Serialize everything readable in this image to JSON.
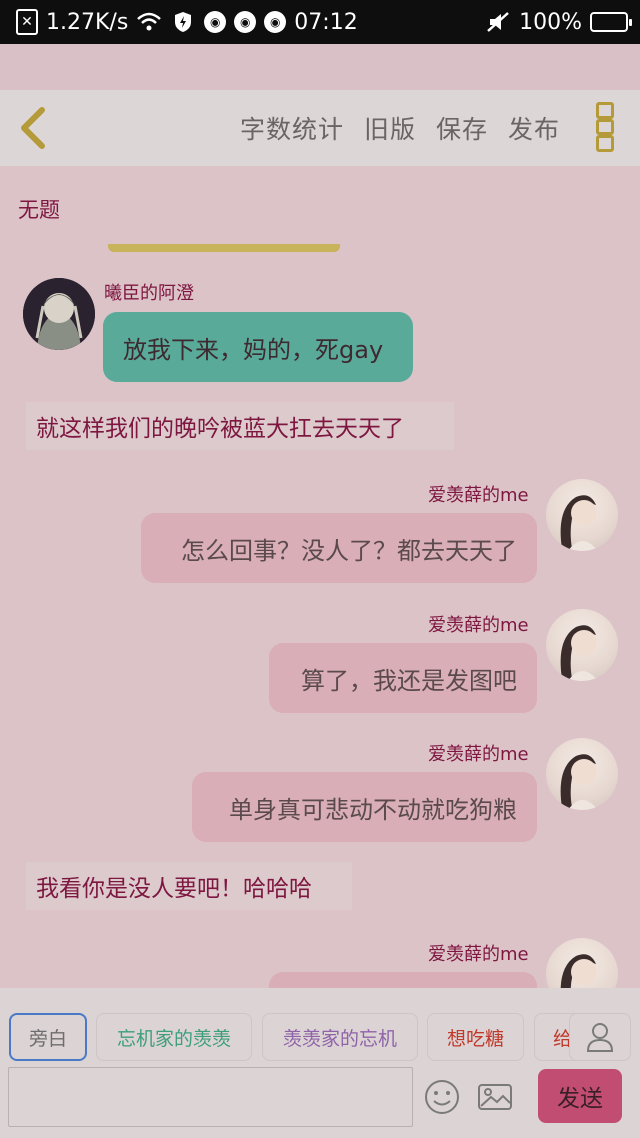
{
  "status_bar": {
    "net_speed": "1.27K/s",
    "time": "07:12",
    "battery": "100%"
  },
  "toolbar": {
    "actions": [
      "字数统计",
      "旧版",
      "保存",
      "发布"
    ]
  },
  "document": {
    "title": "无题"
  },
  "messages": [
    {
      "kind": "left",
      "name": "曦臣的阿澄",
      "text": "放我下来，妈的，死gay"
    },
    {
      "kind": "narration",
      "text": "就这样我们的晚吟被蓝大扛去天天了"
    },
    {
      "kind": "right",
      "name": "爱羡薛的me",
      "text": "怎么回事？没人了？都去天天了"
    },
    {
      "kind": "right",
      "name": "爱羡薛的me",
      "text": "算了，我还是发图吧"
    },
    {
      "kind": "right",
      "name": "爱羡薛的me",
      "text": "单身真可悲动不动就吃狗粮"
    },
    {
      "kind": "narration",
      "text": "我看你是没人要吧！哈哈哈"
    },
    {
      "kind": "right",
      "name": "爱羡薛的me",
      "text": ""
    }
  ],
  "role_chips": [
    {
      "label": "旁白",
      "color": "#6d6d6d"
    },
    {
      "label": "忘机家的羡羡",
      "color": "#3d9e7e"
    },
    {
      "label": "羡羡家的忘机",
      "color": "#8f63a8"
    },
    {
      "label": "想吃糖",
      "color": "#c0392b"
    },
    {
      "label": "给",
      "color": "#c0392b"
    }
  ],
  "composer": {
    "send_label": "发送"
  }
}
